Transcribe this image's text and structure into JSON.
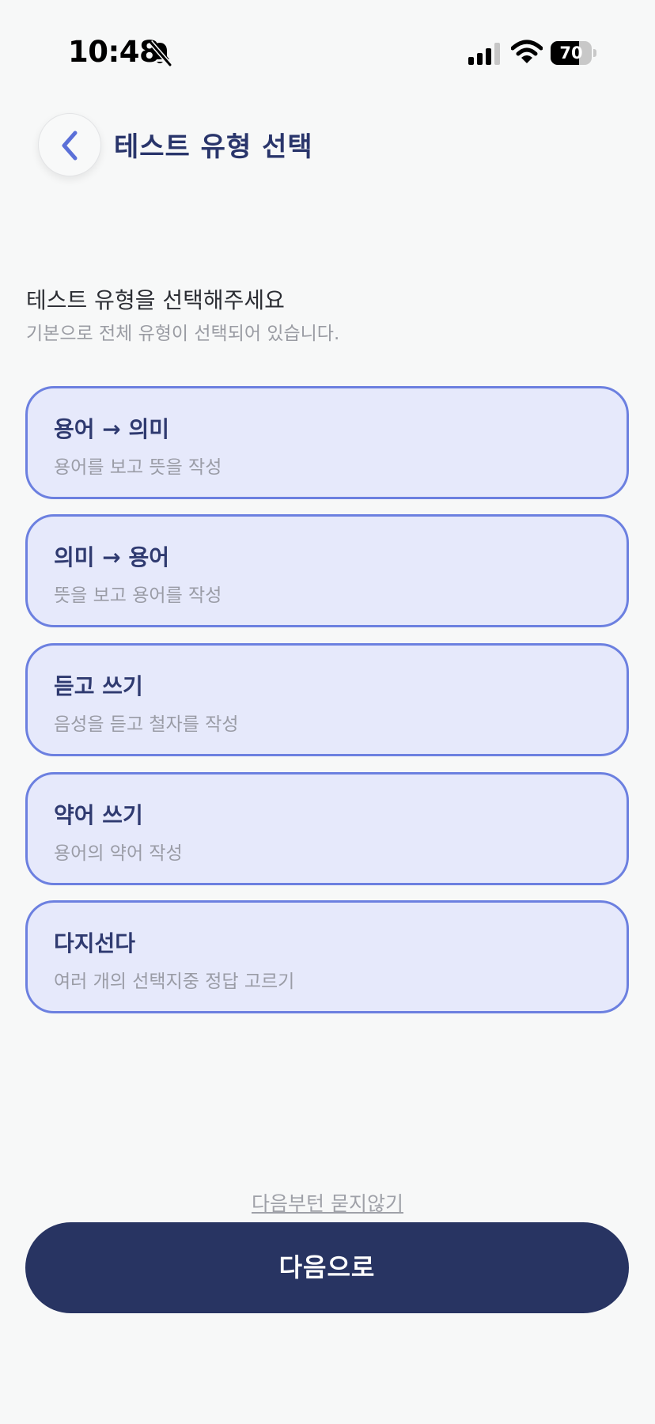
{
  "status_bar": {
    "time": "10:48",
    "battery_level": "70",
    "icons": [
      "bell-slash-icon",
      "cellular-signal-icon",
      "wifi-icon",
      "battery-icon"
    ]
  },
  "header": {
    "back_icon": "chevron-left-icon",
    "title": "테스트 유형 선택"
  },
  "prompt": {
    "title": "테스트 유형을 선택해주세요",
    "subtitle": "기본으로 전체 유형이 선택되어 있습니다."
  },
  "options": [
    {
      "title": "용어 → 의미",
      "description": "용어를 보고 뜻을 작성",
      "selected": true
    },
    {
      "title": "의미 → 용어",
      "description": "뜻을 보고 용어를 작성",
      "selected": true
    },
    {
      "title": "듣고 쓰기",
      "description": "음성을 듣고 철자를 작성",
      "selected": true
    },
    {
      "title": "약어 쓰기",
      "description": "용어의 약어 작성",
      "selected": true
    },
    {
      "title": "다지선다",
      "description": "여러 개의 선택지중 정답 고르기",
      "selected": true
    }
  ],
  "footer": {
    "skip_label": "다음부턴 묻지않기",
    "next_label": "다음으로"
  },
  "colors": {
    "accent": "#6c80e0",
    "card_background": "#e6e9fb",
    "primary_dark": "#283462",
    "background": "#f7f8f8"
  }
}
